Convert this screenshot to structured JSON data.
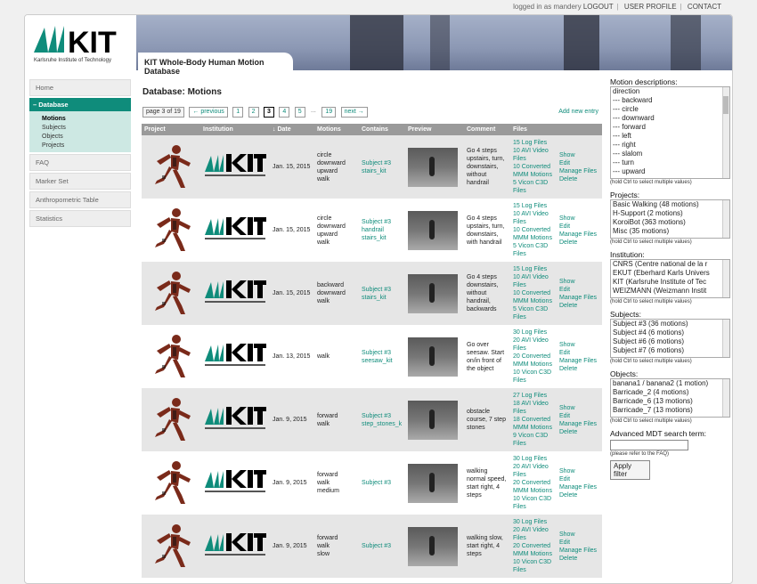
{
  "toplinks": {
    "logged": "logged in as mandery",
    "logout": "LOGOUT",
    "profile": "USER PROFILE",
    "contact": "CONTACT"
  },
  "header": {
    "logo_text": "KIT",
    "logo_sub": "Karlsruhe Institute of Technology",
    "db_title": "KIT Whole-Body Human Motion Database"
  },
  "sidebar": {
    "home": "Home",
    "database": "– Database",
    "sub": [
      "Motions",
      "Subjects",
      "Objects",
      "Projects"
    ],
    "others": [
      "FAQ",
      "Marker Set",
      "Anthropometric Table",
      "Statistics"
    ]
  },
  "main": {
    "title": "Database: Motions",
    "page_info": "page 3 of 19",
    "prev": "← previous",
    "pages": [
      "1",
      "2",
      "3",
      "4",
      "5"
    ],
    "dots": "...",
    "last": "19",
    "next": "next →",
    "add": "Add new entry",
    "columns": [
      "Project",
      "Institution",
      "↓ Date",
      "Motions",
      "Contains",
      "Preview",
      "Comment",
      "Files",
      ""
    ]
  },
  "rows": [
    {
      "date": "Jan. 15, 2015",
      "motions": "circle\ndownward\nupward\nwalk",
      "contains": "Subject #3\nstairs_kit",
      "comment": "Go 4 steps upstairs, turn, downstairs, without handrail",
      "files": [
        "15 Log Files",
        "10 AVI Video Files",
        "10 Converted MMM Motions",
        "5 Vicon C3D Files"
      ]
    },
    {
      "date": "Jan. 15, 2015",
      "motions": "circle\ndownward\nupward\nwalk",
      "contains": "Subject #3\nhandrail\nstairs_kit",
      "comment": "Go 4 steps upstairs, turn, downstairs, with handrail",
      "files": [
        "15 Log Files",
        "10 AVI Video Files",
        "10 Converted MMM Motions",
        "5 Vicon C3D Files"
      ]
    },
    {
      "date": "Jan. 15, 2015",
      "motions": "backward\ndownward\nwalk",
      "contains": "Subject #3\nstairs_kit",
      "comment": "Go 4 steps downstairs, without handrail, backwards",
      "files": [
        "15 Log Files",
        "10 AVI Video Files",
        "10 Converted MMM Motions",
        "5 Vicon C3D Files"
      ]
    },
    {
      "date": "Jan. 13, 2015",
      "motions": "walk",
      "contains": "Subject #3\nseesaw_kit",
      "comment": "Go over seesaw. Start on/in front of the object",
      "files": [
        "30 Log Files",
        "20 AVI Video Files",
        "20 Converted MMM Motions",
        "10 Vicon C3D Files"
      ]
    },
    {
      "date": "Jan. 9, 2015",
      "motions": "forward\nwalk",
      "contains": "Subject #3\nstep_stones_k",
      "comment": "obstacle course, 7 step stones",
      "files": [
        "27 Log Files",
        "18 AVI Video Files",
        "18 Converted MMM Motions",
        "9 Vicon C3D Files"
      ]
    },
    {
      "date": "Jan. 9, 2015",
      "motions": "forward\nwalk\nmedium",
      "contains": "Subject #3",
      "comment": "walking normal speed, start right, 4 steps",
      "files": [
        "30 Log Files",
        "20 AVI Video Files",
        "20 Converted MMM Motions",
        "10 Vicon C3D Files"
      ]
    },
    {
      "date": "Jan. 9, 2015",
      "motions": "forward\nwalk\nslow",
      "contains": "Subject #3",
      "comment": "walking slow, start right, 4 steps",
      "files": [
        "30 Log Files",
        "20 AVI Video Files",
        "20 Converted MMM Motions",
        "10 Vicon C3D Files"
      ]
    }
  ],
  "row_actions": [
    "Show",
    "Edit",
    "Manage Files",
    "Delete"
  ],
  "filters": {
    "motion_label": "Motion descriptions:",
    "motion_opts": [
      "direction",
      "--- backward",
      "--- circle",
      "--- downward",
      "--- forward",
      "--- left",
      "--- right",
      "--- slalom",
      "--- turn",
      "--- upward"
    ],
    "hint": "(hold Ctrl to select multiple values)",
    "projects_label": "Projects:",
    "projects": [
      "Basic Walking (48 motions)",
      "H-Support (2 motions)",
      "KoroiBot (363 motions)",
      "Misc (35 motions)"
    ],
    "institution_label": "Institution:",
    "institutions": [
      "CNRS (Centre national de la r",
      "EKUT (Eberhard Karls Univers",
      "KIT (Karlsruhe Institute of Tec",
      "WEIZMANN (Weizmann Instit"
    ],
    "subjects_label": "Subjects:",
    "subjects": [
      "Subject #3 (36 motions)",
      "Subject #4 (6 motions)",
      "Subject #6 (6 motions)",
      "Subject #7 (6 motions)"
    ],
    "objects_label": "Objects:",
    "objects": [
      "banana1 / banana2 (1 motion)",
      "Barricade_2 (4 motions)",
      "Barricade_6 (13 motions)",
      "Barricade_7 (13 motions)"
    ],
    "mdt_label": "Advanced MDT search term:",
    "mdt_hint": "(please refer to the FAQ)",
    "apply": "Apply filter"
  },
  "colors": {
    "accent": "#0f8c7b"
  }
}
